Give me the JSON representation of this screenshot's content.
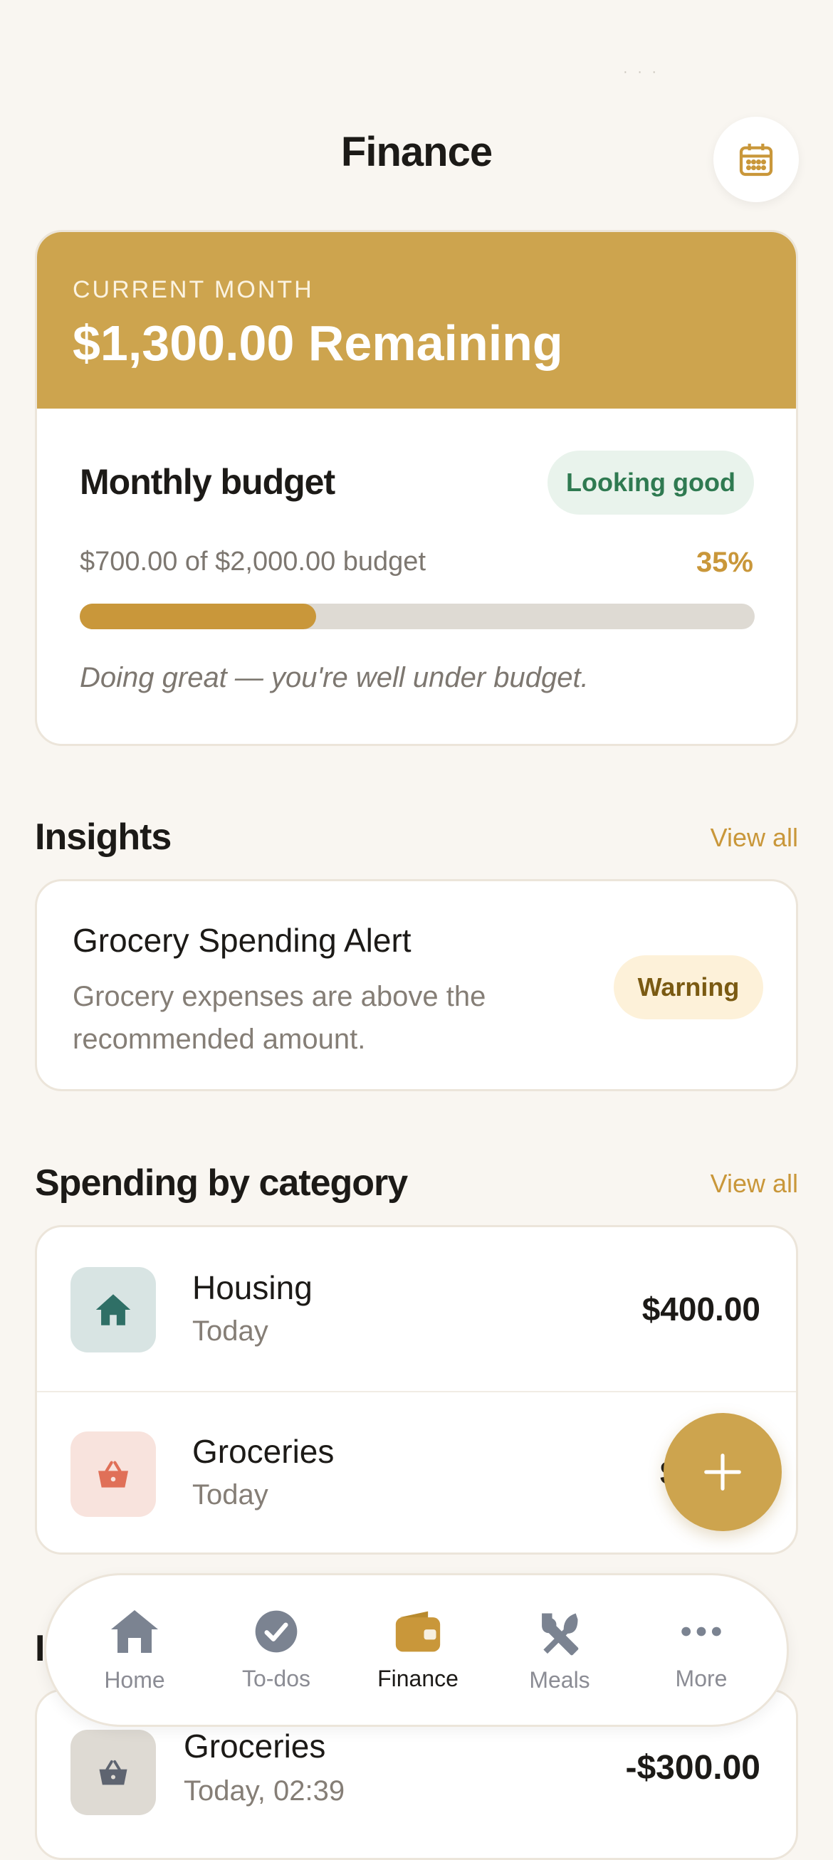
{
  "header": {
    "title": "Finance",
    "calendar_icon": "calendar-icon"
  },
  "summary": {
    "eyebrow": "CURRENT MONTH",
    "headline": "$1,300.00 Remaining",
    "accent_color": "#cda44e"
  },
  "budget": {
    "title": "Monthly budget",
    "status_badge": "Looking good",
    "progress_text": "$700.00 of $2,000.00 budget",
    "percent_label": "35%",
    "progress_fraction": 0.35,
    "message": "Doing great — you're well under budget."
  },
  "insights": {
    "section_title": "Insights",
    "view_all": "View all",
    "items": [
      {
        "title": "Grocery Spending Alert",
        "description_line1": "Grocery expenses are above the",
        "description_line2": "recommended amount.",
        "badge": "Warning"
      }
    ]
  },
  "categories": {
    "section_title": "Spending by category",
    "view_all": "View all",
    "items": [
      {
        "name": "Housing",
        "subtitle": "Today",
        "amount": "$400.00",
        "icon": "house-icon"
      },
      {
        "name": "Groceries",
        "subtitle": "Today",
        "amount": "$3",
        "icon": "basket-icon"
      }
    ]
  },
  "transactions": {
    "section_title_partial": "I",
    "items": [
      {
        "name": "Groceries",
        "subtitle": "Today, 02:39",
        "amount": "-$300.00",
        "icon": "basket-icon"
      }
    ]
  },
  "fab": {
    "icon": "plus-icon"
  },
  "nav": {
    "items": [
      {
        "label": "Home",
        "icon": "home-icon",
        "active": false
      },
      {
        "label": "To-dos",
        "icon": "check-circle-icon",
        "active": false
      },
      {
        "label": "Finance",
        "icon": "wallet-icon",
        "active": true
      },
      {
        "label": "Meals",
        "icon": "utensils-icon",
        "active": false
      },
      {
        "label": "More",
        "icon": "more-dots-icon",
        "active": false
      }
    ]
  }
}
